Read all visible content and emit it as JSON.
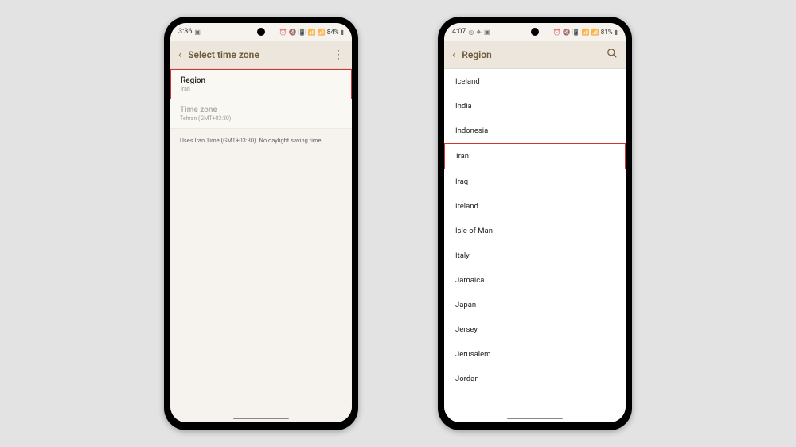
{
  "phone1": {
    "status": {
      "time": "3:36",
      "battery": "84%"
    },
    "appbar": {
      "title": "Select time zone"
    },
    "region": {
      "label": "Region",
      "value": "Iran"
    },
    "timezone": {
      "label": "Time zone",
      "value": "Tehran (GMT+03:30)"
    },
    "info": "Uses Iran Time (GMT+03:30). No daylight saving time."
  },
  "phone2": {
    "status": {
      "time": "4:07",
      "battery": "81%"
    },
    "appbar": {
      "title": "Region"
    },
    "regions": {
      "r0": "Iceland",
      "r1": "India",
      "r2": "Indonesia",
      "r3": "Iran",
      "r4": "Iraq",
      "r5": "Ireland",
      "r6": "Isle of Man",
      "r7": "Italy",
      "r8": "Jamaica",
      "r9": "Japan",
      "r10": "Jersey",
      "r11": "Jerusalem",
      "r12": "Jordan"
    }
  }
}
